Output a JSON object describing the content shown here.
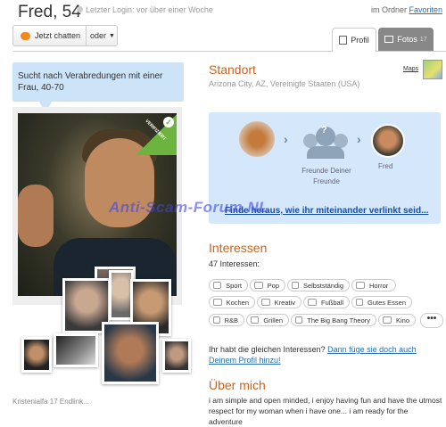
{
  "header": {
    "name_age": "Fred, 54",
    "last_login": "Letzter Login: vor über einer Woche",
    "folder_prefix": "im Ordner",
    "folder_link": "Favoriten"
  },
  "actions": {
    "chat_label": "Jetzt chatten",
    "or_label": "oder"
  },
  "tabs": {
    "profile": "Profil",
    "photos": "Fotos",
    "photos_count": "17"
  },
  "seeking": "Sucht nach Verabredungen mit einer Frau, 40-70",
  "photo": {
    "verified_label": "VERIFIZIERT",
    "bottom_watermark": "Kristenialfa 17 Endlink..."
  },
  "watermark": "Anti-Scam-Forum.NL",
  "location": {
    "heading": "Standort",
    "value": "Arizona City, AZ, Vereinigte Staaten (USA)",
    "maps_label": "Maps"
  },
  "connection": {
    "friends_label": "Freunde Deiner Freunde",
    "fred_label": "Fred",
    "link": "Finde heraus, wie ihr miteinander verlinkt seid..."
  },
  "interests": {
    "heading": "Interessen",
    "count": "47 Interessen:",
    "rows": [
      [
        "Sport",
        "Pop",
        "Selbstständig",
        "Horror"
      ],
      [
        "Kochen",
        "Kreativ",
        "Fußball",
        "Gutes Essen"
      ],
      [
        "R&B",
        "Grillen",
        "The Big Bang Theory",
        "Kino"
      ]
    ],
    "more": "•••",
    "same_prefix": "Ihr habt die gleichen Interessen?",
    "same_link": "Dann füge sie doch auch Deinem Profil hinzu!"
  },
  "about": {
    "heading": "Über mich",
    "text": "i am simple and open minded, i enjoy having fun and have the utmost respect for my woman when i have one... i am ready for the adventure"
  },
  "colors": {
    "accent": "#c8641e",
    "link": "#2a6fb0",
    "bubble": "#cde3f7",
    "verified": "#6db33f",
    "watermark": "#3c46e6"
  }
}
